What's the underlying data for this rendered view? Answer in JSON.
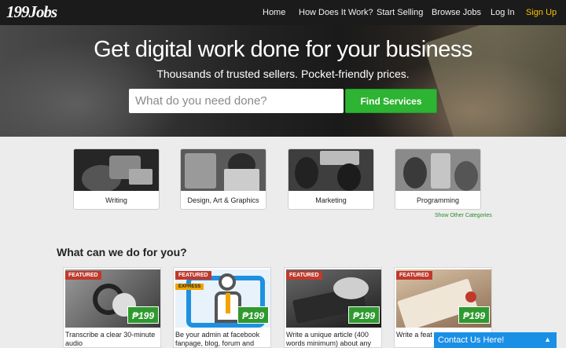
{
  "nav": {
    "logo": "199Jobs",
    "links": [
      "Home",
      "How Does It Work?",
      "Start Selling",
      "Browse Jobs",
      "Log In",
      "Sign Up"
    ]
  },
  "hero": {
    "title": "Get digital work done for your business",
    "subtitle": "Thousands of trusted sellers. Pocket-friendly prices.",
    "search_placeholder": "What do you need done?",
    "search_button": "Find Services"
  },
  "categories": [
    "Writing",
    "Design, Art & Graphics",
    "Marketing",
    "Programming"
  ],
  "show_other": "Show Other Categories",
  "section_title": "What can we do for you?",
  "cards": [
    {
      "badge": "FEATURED",
      "price": "₱199",
      "desc": "Transcribe a clear 30-minute audio"
    },
    {
      "badge": "FEATURED",
      "express": "EXPRESS",
      "price": "₱199",
      "desc": "Be your admin at facebook fanpage, blog, forum and"
    },
    {
      "badge": "FEATURED",
      "price": "₱199",
      "desc": "Write a unique article (400 words minimum) about any"
    },
    {
      "badge": "FEATURED",
      "price": "₱199",
      "desc": "Write a feat essay, or a"
    }
  ],
  "contact": {
    "label": "Contact Us Here!",
    "arrow": "▲"
  },
  "colors": {
    "accent_green": "#2db432",
    "nav_bg": "#1b1b1b",
    "signup": "#f6c400",
    "featured": "#c0392b",
    "contact": "#1a8fe6"
  }
}
